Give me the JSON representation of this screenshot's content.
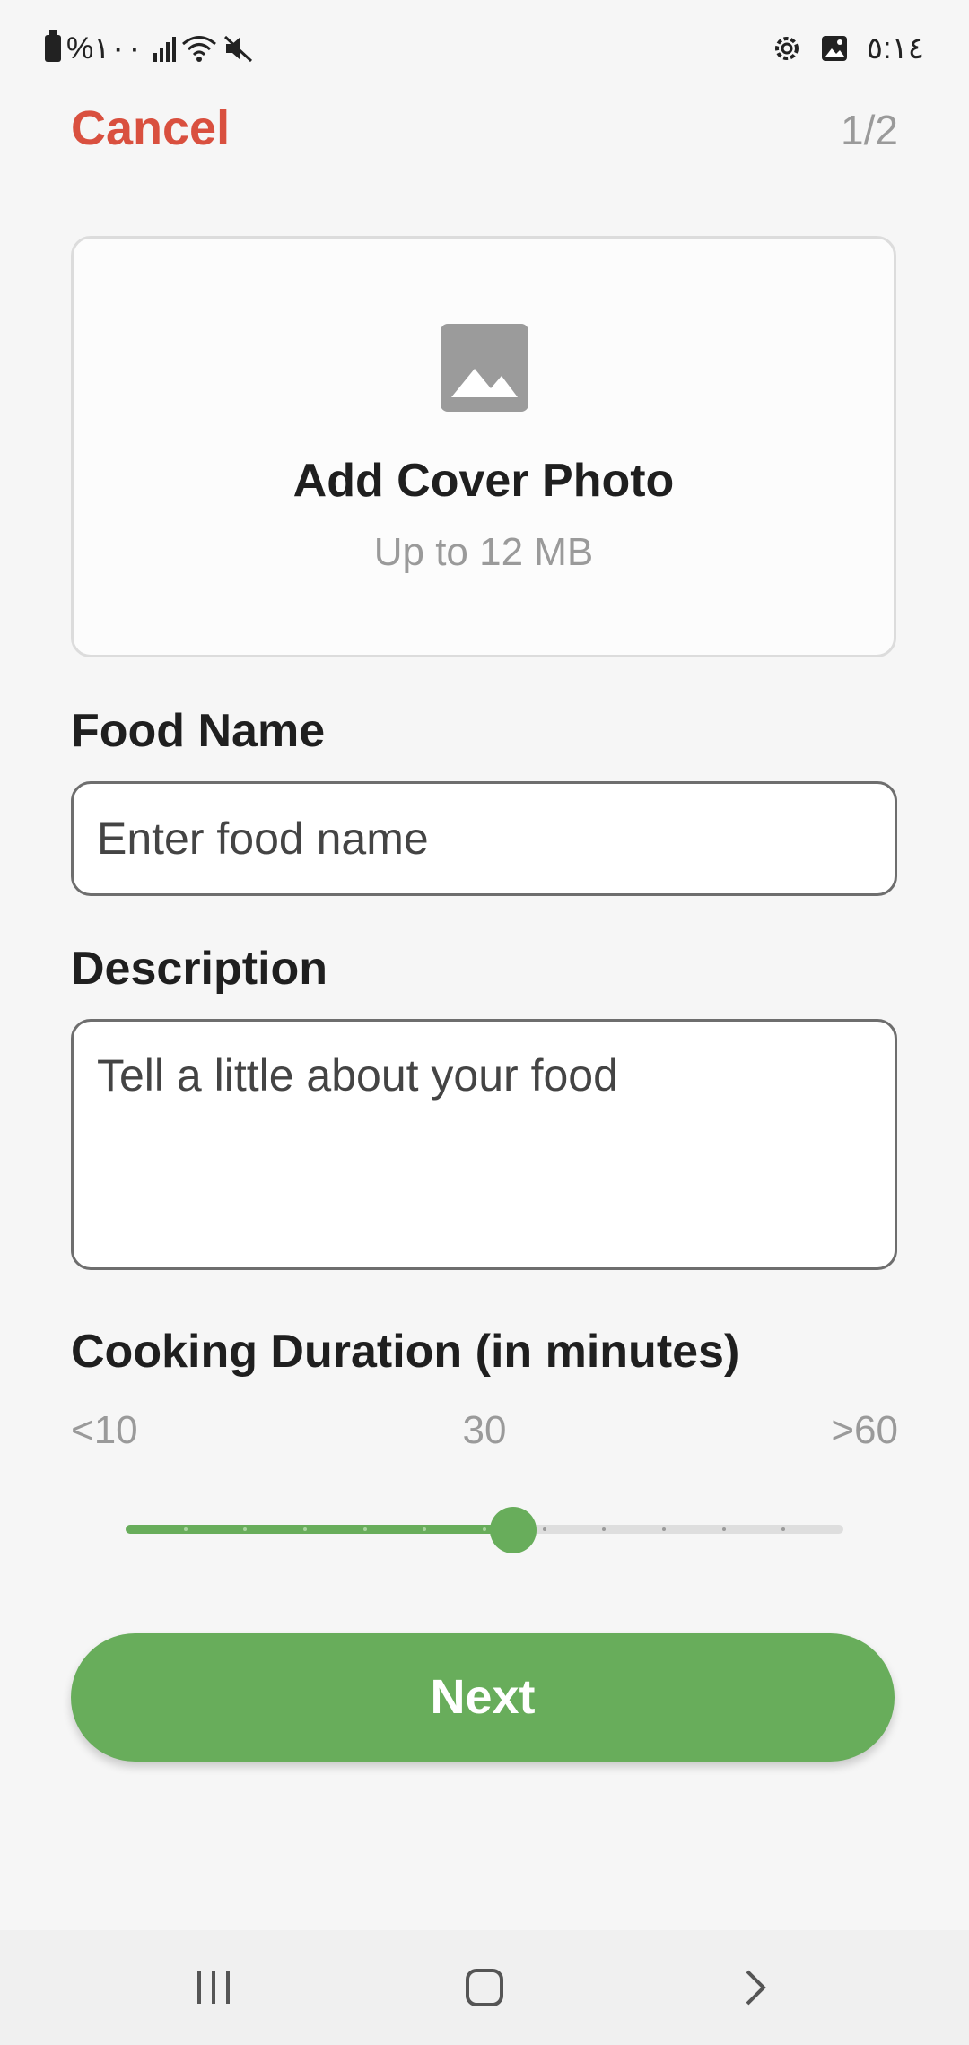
{
  "status_bar": {
    "battery_text": "%١٠٠",
    "time": "٥:١٤"
  },
  "header": {
    "cancel_label": "Cancel",
    "step": "1/2"
  },
  "cover": {
    "title": "Add Cover Photo",
    "subtitle": "Up to 12 MB"
  },
  "food_name": {
    "label": "Food Name",
    "placeholder": "Enter food name",
    "value": ""
  },
  "description": {
    "label": "Description",
    "placeholder": "Tell a little about your food",
    "value": ""
  },
  "duration": {
    "label": "Cooking Duration (in minutes)",
    "min_label": "<10",
    "current_label": "30",
    "max_label": ">60",
    "steps": 12,
    "selected_fraction": 0.54
  },
  "next_button": {
    "label": "Next"
  },
  "colors": {
    "accent": "#68ad5b",
    "cancel": "#d9503f",
    "muted_text": "#9a9a9a"
  },
  "nav": {
    "icons": [
      "recent-apps-icon",
      "home-icon",
      "back-icon"
    ]
  }
}
